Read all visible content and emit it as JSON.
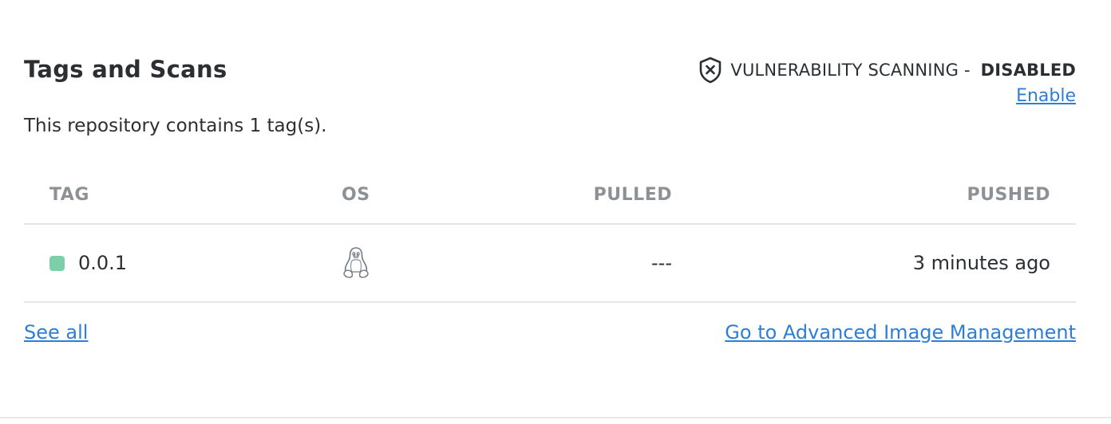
{
  "section": {
    "title": "Tags and Scans",
    "description": "This repository contains 1 tag(s)."
  },
  "scanning": {
    "icon": "shield-x-icon",
    "label": "VULNERABILITY SCANNING - ",
    "state": "DISABLED",
    "enable_label": "Enable"
  },
  "table": {
    "columns": {
      "tag": "TAG",
      "os": "OS",
      "pulled": "PULLED",
      "pushed": "PUSHED"
    },
    "rows": [
      {
        "tag": "0.0.1",
        "status_color": "#7dcfa9",
        "os_icon": "linux-tux-icon",
        "pulled": "---",
        "pushed": "3 minutes ago"
      }
    ]
  },
  "footer": {
    "see_all": "See all",
    "advanced": "Go to Advanced Image Management"
  },
  "colors": {
    "link": "#2d7ed6",
    "text": "#2b2f33",
    "header_text": "#8c9196",
    "status_ok": "#7dcfa9"
  }
}
